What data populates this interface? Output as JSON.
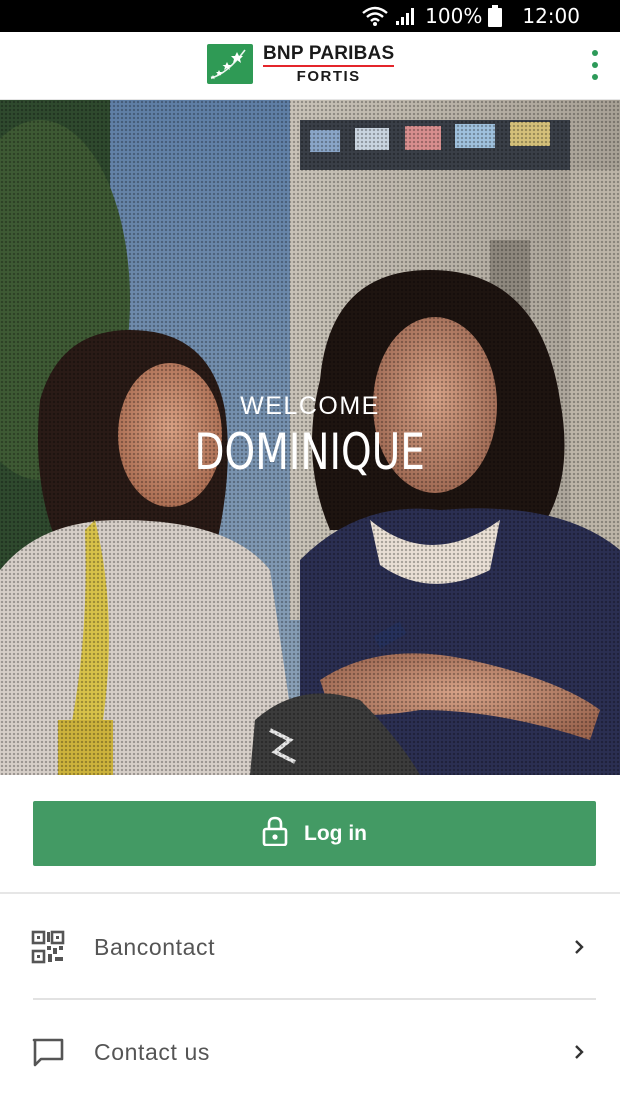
{
  "status_bar": {
    "battery": "100%",
    "time": "12:00",
    "icons": [
      "wifi-icon",
      "signal-icon",
      "battery-icon"
    ]
  },
  "header": {
    "logo_line1": "BNP PARIBAS",
    "logo_line2": "FORTIS",
    "menu_icon": "kebab-menu-icon"
  },
  "hero": {
    "welcome_label": "WELCOME",
    "user_name": "DOMINIQUE"
  },
  "login": {
    "label": "Log in",
    "icon": "lock-icon"
  },
  "menu": {
    "items": [
      {
        "label": "Bancontact",
        "icon": "qr-code-icon"
      },
      {
        "label": "Contact us",
        "icon": "chat-bubble-icon"
      }
    ]
  },
  "colors": {
    "brand_green": "#439a64",
    "logo_green": "#2f9a55",
    "logo_red": "#e4252b",
    "status_bar": "#000000"
  }
}
